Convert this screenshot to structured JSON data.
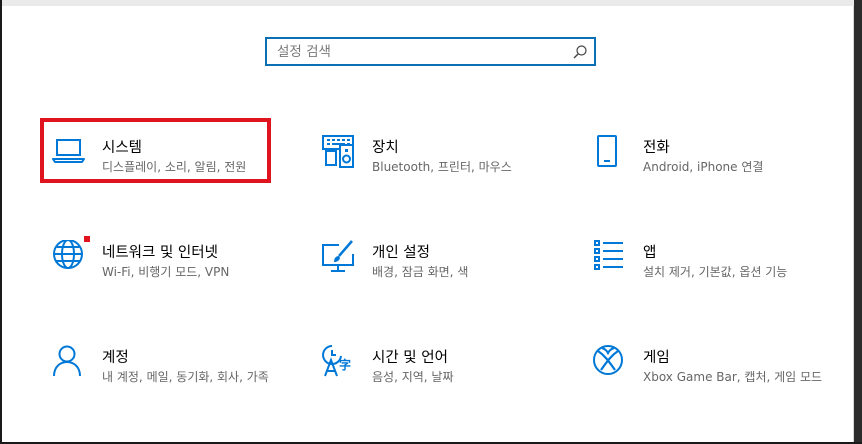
{
  "search": {
    "placeholder": "설정 검색"
  },
  "tiles": [
    {
      "title": "시스템",
      "desc": "디스플레이, 소리, 알림, 전원",
      "icon": "laptop-icon"
    },
    {
      "title": "장치",
      "desc": "Bluetooth, 프린터, 마우스",
      "icon": "devices-icon"
    },
    {
      "title": "전화",
      "desc": "Android, iPhone 연결",
      "icon": "phone-icon"
    },
    {
      "title": "네트워크 및 인터넷",
      "desc": "Wi-Fi, 비행기 모드, VPN",
      "icon": "globe-icon"
    },
    {
      "title": "개인 설정",
      "desc": "배경, 잠금 화면, 색",
      "icon": "personalization-icon"
    },
    {
      "title": "앱",
      "desc": "설치 제거, 기본값, 옵션 기능",
      "icon": "apps-icon"
    },
    {
      "title": "계정",
      "desc": "내 계정, 메일, 동기화, 회사, 가족",
      "icon": "person-icon"
    },
    {
      "title": "시간 및 언어",
      "desc": "음성, 지역, 날짜",
      "icon": "time-language-icon"
    },
    {
      "title": "게임",
      "desc": "Xbox Game Bar, 캡처, 게임 모드",
      "icon": "xbox-icon"
    }
  ],
  "colors": {
    "accent": "#0078d7",
    "highlight": "#e0141e",
    "search_border": "#0a6fb3"
  }
}
